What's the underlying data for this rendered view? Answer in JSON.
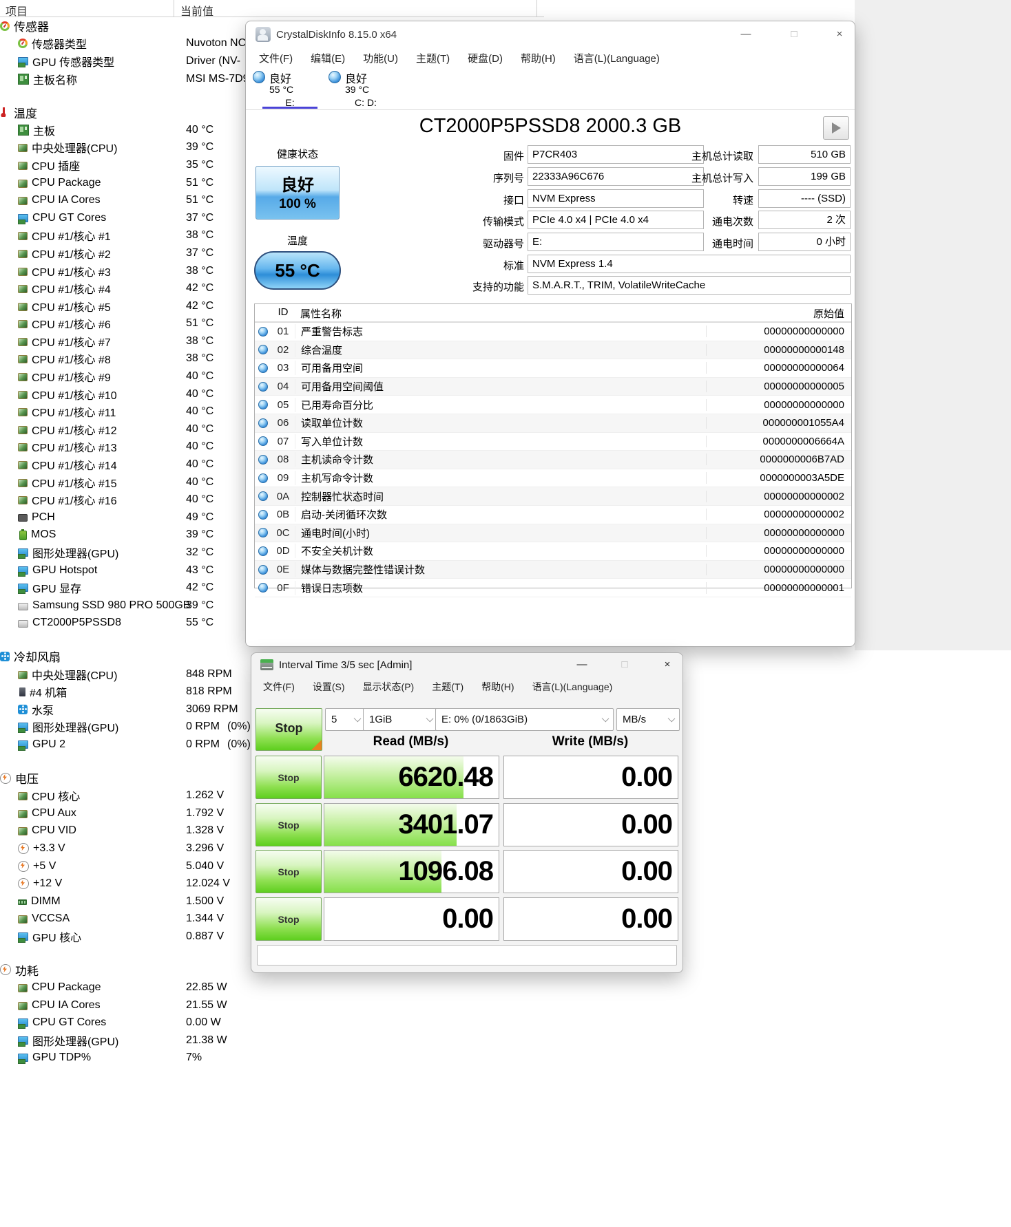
{
  "hwinfo": {
    "columns": {
      "item": "项目",
      "value": "当前值"
    },
    "groups": [
      {
        "label": "传感器",
        "icon": "gauge-icon",
        "rows": [
          {
            "icon": "gauge-icon",
            "label": "传感器类型",
            "value": "Nuvoton NC"
          },
          {
            "icon": "gpu-icon",
            "label": "GPU 传感器类型",
            "value": "Driver  (NV-"
          },
          {
            "icon": "motherboard-icon",
            "label": "主板名称",
            "value": "MSI MS-7D9"
          }
        ]
      },
      {
        "label": "温度",
        "icon": "thermometer-icon",
        "rows": [
          {
            "icon": "motherboard-icon",
            "label": "主板",
            "value": "40 °C"
          },
          {
            "icon": "cpu-icon",
            "label": "中央处理器(CPU)",
            "value": "39 °C"
          },
          {
            "icon": "cpu-icon",
            "label": "CPU 插座",
            "value": "35 °C"
          },
          {
            "icon": "cpu-icon",
            "label": "CPU Package",
            "value": "51 °C"
          },
          {
            "icon": "cpu-icon",
            "label": "CPU IA Cores",
            "value": "51 °C"
          },
          {
            "icon": "gpu-icon",
            "label": "CPU GT Cores",
            "value": "37 °C"
          },
          {
            "icon": "cpu-icon",
            "label": "CPU #1/核心 #1",
            "value": "38 °C"
          },
          {
            "icon": "cpu-icon",
            "label": "CPU #1/核心 #2",
            "value": "37 °C"
          },
          {
            "icon": "cpu-icon",
            "label": "CPU #1/核心 #3",
            "value": "38 °C"
          },
          {
            "icon": "cpu-icon",
            "label": "CPU #1/核心 #4",
            "value": "42 °C"
          },
          {
            "icon": "cpu-icon",
            "label": "CPU #1/核心 #5",
            "value": "42 °C"
          },
          {
            "icon": "cpu-icon",
            "label": "CPU #1/核心 #6",
            "value": "51 °C"
          },
          {
            "icon": "cpu-icon",
            "label": "CPU #1/核心 #7",
            "value": "38 °C"
          },
          {
            "icon": "cpu-icon",
            "label": "CPU #1/核心 #8",
            "value": "38 °C"
          },
          {
            "icon": "cpu-icon",
            "label": "CPU #1/核心 #9",
            "value": "40 °C"
          },
          {
            "icon": "cpu-icon",
            "label": "CPU #1/核心 #10",
            "value": "40 °C"
          },
          {
            "icon": "cpu-icon",
            "label": "CPU #1/核心 #11",
            "value": "40 °C"
          },
          {
            "icon": "cpu-icon",
            "label": "CPU #1/核心 #12",
            "value": "40 °C"
          },
          {
            "icon": "cpu-icon",
            "label": "CPU #1/核心 #13",
            "value": "40 °C"
          },
          {
            "icon": "cpu-icon",
            "label": "CPU #1/核心 #14",
            "value": "40 °C"
          },
          {
            "icon": "cpu-icon",
            "label": "CPU #1/核心 #15",
            "value": "40 °C"
          },
          {
            "icon": "cpu-icon",
            "label": "CPU #1/核心 #16",
            "value": "40 °C"
          },
          {
            "icon": "chip-icon",
            "label": "PCH",
            "value": "49 °C"
          },
          {
            "icon": "battery-icon",
            "label": "MOS",
            "value": "39 °C"
          },
          {
            "icon": "gpu-icon",
            "label": "图形处理器(GPU)",
            "value": "32 °C"
          },
          {
            "icon": "gpu-icon",
            "label": "GPU Hotspot",
            "value": "43 °C"
          },
          {
            "icon": "gpu-icon",
            "label": "GPU 显存",
            "value": "42 °C"
          },
          {
            "icon": "disk-icon",
            "label": "Samsung SSD 980 PRO 500GB",
            "value": "39 °C"
          },
          {
            "icon": "disk-icon",
            "label": "CT2000P5PSSD8",
            "value": "55 °C"
          }
        ]
      },
      {
        "label": "冷却风扇",
        "icon": "fan-icon",
        "rows": [
          {
            "icon": "cpu-icon",
            "label": "中央处理器(CPU)",
            "value": "848 RPM"
          },
          {
            "icon": "case-icon",
            "label": "#4 机箱",
            "value": "818 RPM"
          },
          {
            "icon": "fan-icon",
            "label": "水泵",
            "value": "3069 RPM"
          },
          {
            "icon": "gpu-icon",
            "label": "图形处理器(GPU)",
            "value": "0 RPM",
            "value2": "(0%)"
          },
          {
            "icon": "gpu-icon",
            "label": "GPU 2",
            "value": "0 RPM",
            "value2": "(0%)"
          }
        ]
      },
      {
        "label": "电压",
        "icon": "bolt-icon",
        "rows": [
          {
            "icon": "cpu-icon",
            "label": "CPU 核心",
            "value": "1.262 V"
          },
          {
            "icon": "cpu-icon",
            "label": "CPU Aux",
            "value": "1.792 V"
          },
          {
            "icon": "cpu-icon",
            "label": "CPU VID",
            "value": "1.328 V"
          },
          {
            "icon": "bolt-icon",
            "label": "+3.3 V",
            "value": "3.296 V"
          },
          {
            "icon": "bolt-icon",
            "label": "+5 V",
            "value": "5.040 V"
          },
          {
            "icon": "bolt-icon",
            "label": "+12 V",
            "value": "12.024 V"
          },
          {
            "icon": "ram-icon",
            "label": "DIMM",
            "value": "1.500 V"
          },
          {
            "icon": "cpu-icon",
            "label": "VCCSA",
            "value": "1.344 V"
          },
          {
            "icon": "gpu-icon",
            "label": "GPU 核心",
            "value": "0.887 V"
          }
        ]
      },
      {
        "label": "功耗",
        "icon": "bolt-icon",
        "rows": [
          {
            "icon": "cpu-icon",
            "label": "CPU Package",
            "value": "22.85 W"
          },
          {
            "icon": "cpu-icon",
            "label": "CPU IA Cores",
            "value": "21.55 W"
          },
          {
            "icon": "gpu-icon",
            "label": "CPU GT Cores",
            "value": "0.00 W"
          },
          {
            "icon": "gpu-icon",
            "label": "图形处理器(GPU)",
            "value": "21.38 W"
          },
          {
            "icon": "gpu-icon",
            "label": "GPU TDP%",
            "value": "7%"
          }
        ]
      }
    ]
  },
  "diskinfo": {
    "title": "CrystalDiskInfo 8.15.0 x64",
    "menus": [
      "文件(F)",
      "编辑(E)",
      "功能(U)",
      "主题(T)",
      "硬盘(D)",
      "帮助(H)",
      "语言(L)(Language)"
    ],
    "drive_tabs": [
      {
        "status": "良好",
        "temp": "55 °C",
        "letter": "E:",
        "selected": true
      },
      {
        "status": "良好",
        "temp": "39 °C",
        "letter": "C: D:",
        "selected": false
      }
    ],
    "model": "CT2000P5PSSD8 2000.3 GB",
    "health": {
      "label": "健康状态",
      "status": "良好",
      "percent": "100 %"
    },
    "temperature": {
      "label": "温度",
      "value": "55 °C"
    },
    "fields_left": [
      {
        "label": "固件",
        "value": "P7CR403",
        "wide": false
      },
      {
        "label": "序列号",
        "value": "22333A96C676",
        "wide": false
      },
      {
        "label": "接口",
        "value": "NVM Express",
        "wide": false
      },
      {
        "label": "传输模式",
        "value": "PCIe 4.0 x4 | PCIe 4.0 x4",
        "wide": false
      },
      {
        "label": "驱动器号",
        "value": "E:",
        "wide": false
      },
      {
        "label": "标准",
        "value": "NVM Express 1.4",
        "wide": true
      },
      {
        "label": "支持的功能",
        "value": "S.M.A.R.T., TRIM, VolatileWriteCache",
        "wide": true
      }
    ],
    "fields_right": [
      {
        "label": "主机总计读取",
        "value": "510 GB"
      },
      {
        "label": "主机总计写入",
        "value": "199 GB"
      },
      {
        "label": "转速",
        "value": "---- (SSD)"
      },
      {
        "label": "通电次数",
        "value": "2 次"
      },
      {
        "label": "通电时间",
        "value": "0 小时"
      }
    ],
    "smart": {
      "headers": {
        "id": "ID",
        "name": "属性名称",
        "raw": "原始值"
      },
      "rows": [
        {
          "id": "01",
          "name": "严重警告标志",
          "raw": "00000000000000"
        },
        {
          "id": "02",
          "name": "综合温度",
          "raw": "00000000000148"
        },
        {
          "id": "03",
          "name": "可用备用空间",
          "raw": "00000000000064"
        },
        {
          "id": "04",
          "name": "可用备用空间阈值",
          "raw": "00000000000005"
        },
        {
          "id": "05",
          "name": "已用寿命百分比",
          "raw": "00000000000000"
        },
        {
          "id": "06",
          "name": "读取单位计数",
          "raw": "000000001055A4"
        },
        {
          "id": "07",
          "name": "写入单位计数",
          "raw": "0000000006664A"
        },
        {
          "id": "08",
          "name": "主机读命令计数",
          "raw": "0000000006B7AD"
        },
        {
          "id": "09",
          "name": "主机写命令计数",
          "raw": "0000000003A5DE"
        },
        {
          "id": "0A",
          "name": "控制器忙状态时间",
          "raw": "00000000000002"
        },
        {
          "id": "0B",
          "name": "启动-关闭循环次数",
          "raw": "00000000000002"
        },
        {
          "id": "0C",
          "name": "通电时间(小时)",
          "raw": "00000000000000"
        },
        {
          "id": "0D",
          "name": "不安全关机计数",
          "raw": "00000000000000"
        },
        {
          "id": "0E",
          "name": "媒体与数据完整性错误计数",
          "raw": "00000000000000"
        },
        {
          "id": "0F",
          "name": "错误日志项数",
          "raw": "00000000000001"
        }
      ]
    }
  },
  "diskmark": {
    "title": "Interval Time 3/5 sec [Admin]",
    "menus": [
      "文件(F)",
      "设置(S)",
      "显示状态(P)",
      "主题(T)",
      "帮助(H)",
      "语言(L)(Language)"
    ],
    "toolbar": {
      "stop_label": "Stop",
      "count": "5",
      "size": "1GiB",
      "target": "E: 0% (0/1863GiB)",
      "unit": "MB/s"
    },
    "headers": {
      "read": "Read (MB/s)",
      "write": "Write (MB/s)"
    },
    "rows": [
      {
        "stop_label": "Stop",
        "read": "6620.48",
        "write": "0.00",
        "read_fill_pct": 80,
        "write_fill_pct": 0
      },
      {
        "stop_label": "Stop",
        "read": "3401.07",
        "write": "0.00",
        "read_fill_pct": 76,
        "write_fill_pct": 0
      },
      {
        "stop_label": "Stop",
        "read": "1096.08",
        "write": "0.00",
        "read_fill_pct": 67,
        "write_fill_pct": 0
      },
      {
        "stop_label": "Stop",
        "read": "0.00",
        "write": "0.00",
        "read_fill_pct": 0,
        "write_fill_pct": 0
      }
    ]
  }
}
